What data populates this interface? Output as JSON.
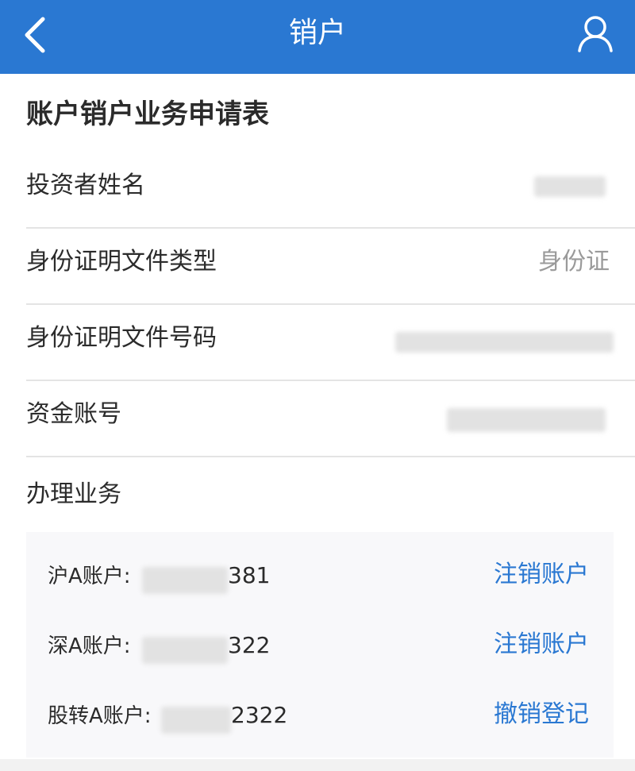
{
  "header": {
    "title": "销户",
    "back_icon": "chevron-left-icon",
    "user_icon": "user-icon",
    "color": "#2a78d2"
  },
  "form": {
    "title": "账户销户业务申请表",
    "rows": [
      {
        "label": "投资者姓名",
        "value": ""
      },
      {
        "label": "身份证明文件类型",
        "value": "身份证"
      },
      {
        "label": "身份证明文件号码",
        "value": ""
      },
      {
        "label": "资金账号",
        "value": ""
      }
    ],
    "section_label": "办理业务"
  },
  "accounts": [
    {
      "label": "沪A账户:",
      "number_tail": "381",
      "action": "注销账户"
    },
    {
      "label": "深A账户:",
      "number_tail": "322",
      "action": "注销账户"
    },
    {
      "label": "股转A账户:",
      "number_tail": "2322",
      "action": "撤销登记"
    }
  ]
}
